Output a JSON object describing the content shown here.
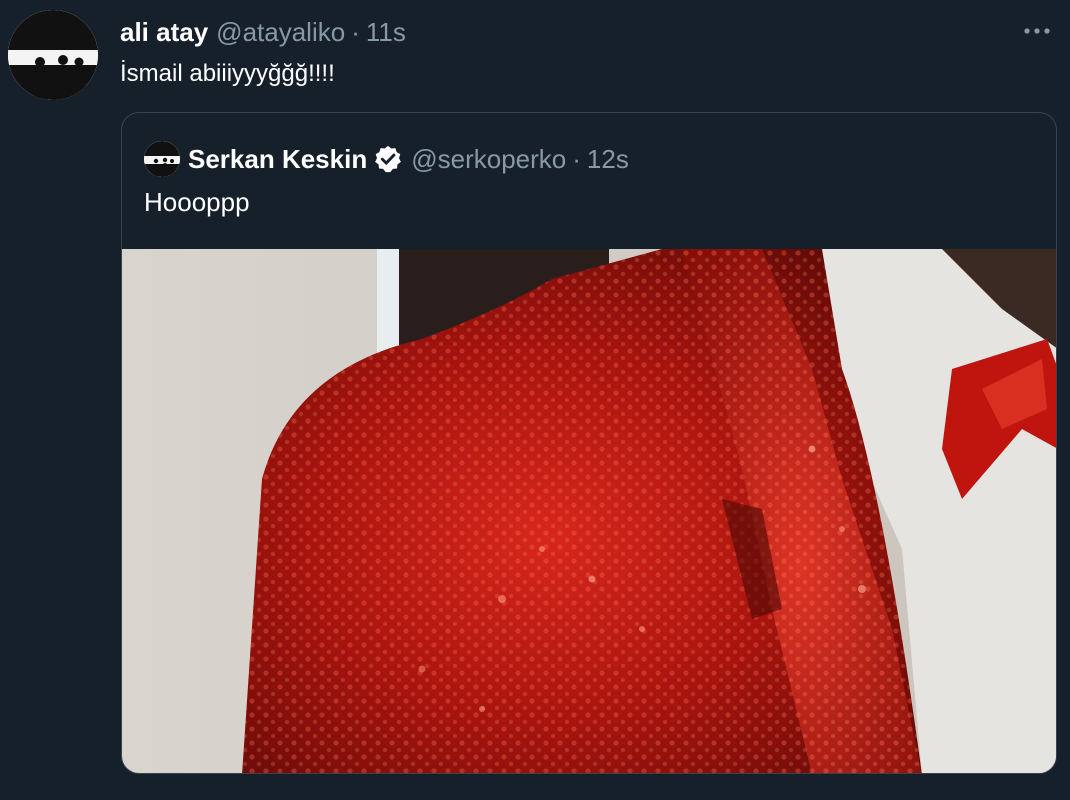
{
  "tweet": {
    "author_name": "ali atay",
    "author_handle": "@atayaliko",
    "separator": "·",
    "time": "11s",
    "text": "İsmail abiiiyyyğğğ!!!!",
    "more_icon": "more-horizontal-icon"
  },
  "quoted_tweet": {
    "author_name": "Serkan Keskin",
    "verified": true,
    "verified_icon": "verified-badge-icon",
    "author_handle": "@serkoperko",
    "separator": "·",
    "time": "12s",
    "text": "Hoooppp"
  },
  "colors": {
    "background": "#15202b",
    "border": "#38444d",
    "secondary_text": "#8899a6",
    "verified_badge": "#ffffff",
    "jacket_red": "#b4140f"
  }
}
